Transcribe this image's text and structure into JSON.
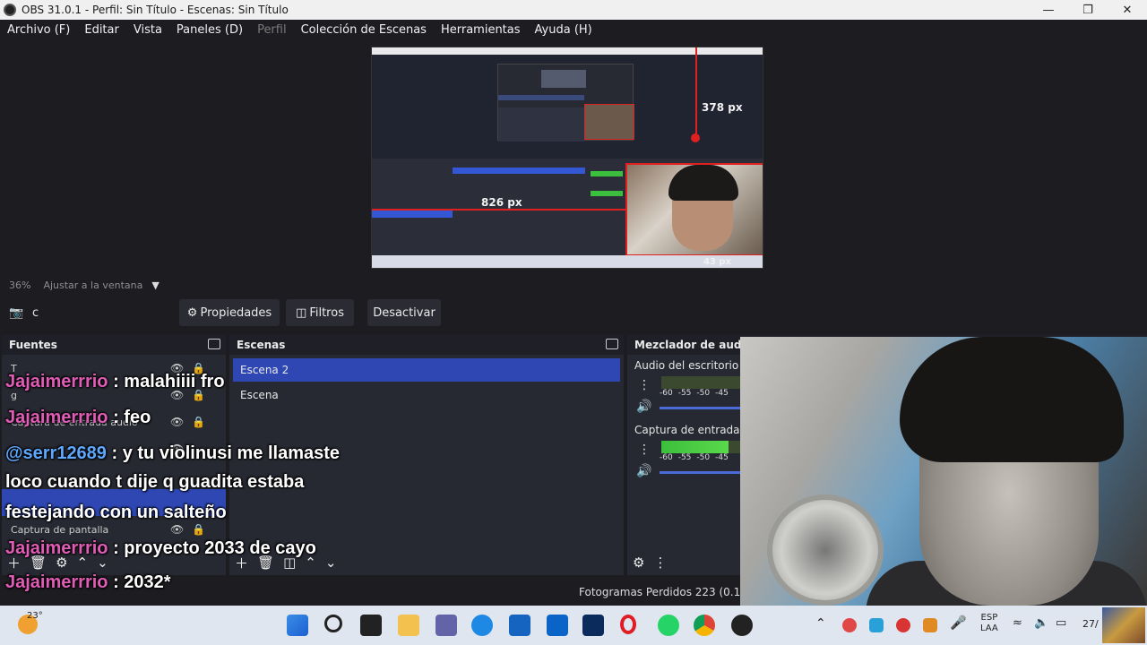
{
  "window": {
    "title": "OBS 31.0.1 - Perfil: Sin Título - Escenas: Sin Título"
  },
  "menu": [
    {
      "label": "Archivo (F)",
      "enabled": true
    },
    {
      "label": "Editar",
      "enabled": true
    },
    {
      "label": "Vista",
      "enabled": true
    },
    {
      "label": "Paneles (D)",
      "enabled": true
    },
    {
      "label": "Perfil",
      "enabled": false
    },
    {
      "label": "Colección de Escenas",
      "enabled": true
    },
    {
      "label": "Herramientas",
      "enabled": true
    },
    {
      "label": "Ayuda (H)",
      "enabled": true
    }
  ],
  "preview": {
    "label_height": "378 px",
    "label_width": "826 px",
    "label_small": "43 px"
  },
  "zoom": {
    "percent": "36%",
    "fit_label": "Ajustar a la ventana"
  },
  "toolbar": {
    "source_name": "c",
    "properties_label": "Propiedades",
    "filters_label": "Filtros",
    "deactivate_label": "Desactivar"
  },
  "sources": {
    "title": "Fuentes",
    "items": [
      {
        "label": "T"
      },
      {
        "label": "g"
      },
      {
        "label": "Captura de entrada audio"
      },
      {
        "label": ""
      },
      {
        "label": ""
      },
      {
        "label": ""
      },
      {
        "label": "Captura de pantalla"
      }
    ]
  },
  "scenes": {
    "title": "Escenas",
    "items": [
      {
        "label": "Escena 2",
        "selected": true
      },
      {
        "label": "Escena",
        "selected": false
      }
    ]
  },
  "mixer": {
    "title": "Mezclador de audio",
    "channels": [
      {
        "name": "Audio del escritorio",
        "level": 0.0,
        "scale": [
          "-60",
          "-55",
          "-50",
          "-45"
        ]
      },
      {
        "name": "Captura de entrada a",
        "level": 0.85,
        "scale": [
          "-60",
          "-55",
          "-50",
          "-45"
        ]
      }
    ]
  },
  "status": {
    "dropped_frames": "Fotogramas Perdidos 223 (0.1%)"
  },
  "chat": [
    {
      "user": "Jajaimerrrio",
      "text": " : malahiiii fro",
      "color": "#e05cb6"
    },
    {
      "user": "Jajaimerrrio",
      "text": " : feo",
      "color": "#e05cb6"
    },
    {
      "user": "@serr12689",
      "text": " : y tu violinusi me llamaste",
      "color": "#5ea8ff"
    },
    {
      "user": "",
      "text": "loco cuando t dije q guadita estaba",
      "color": ""
    },
    {
      "user": "",
      "text": "festejando con un salteño",
      "color": ""
    },
    {
      "user": "Jajaimerrrio",
      "text": " : proyecto 2033 de cayo",
      "color": "#e05cb6"
    },
    {
      "user": "Jajaimerrrio",
      "text": " : 2032*",
      "color": "#e05cb6"
    }
  ],
  "taskbar": {
    "weather_temp": "23°",
    "lang_line1": "ESP",
    "lang_line2": "LAA",
    "clock": "27/"
  },
  "colors": {
    "accent": "#2e47b3",
    "bg": "#1d1d21",
    "dock": "#272932",
    "chat_user": "#e05cb6"
  }
}
